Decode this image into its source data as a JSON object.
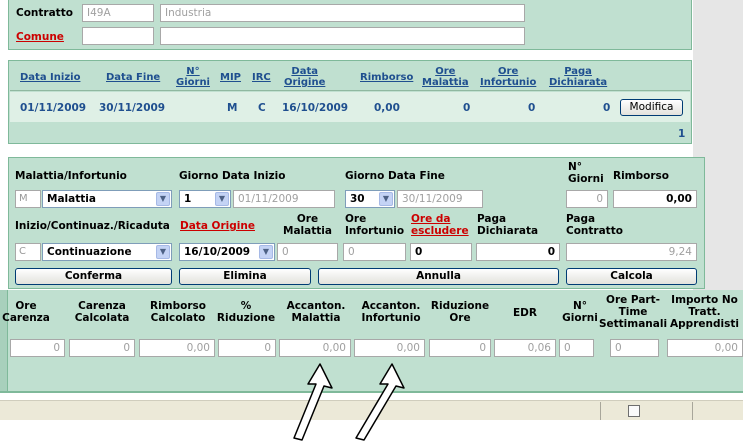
{
  "top": {
    "contratto_label": "Contratto",
    "contratto_code": "I49A",
    "contratto_desc": "Industria",
    "comune_label": "Comune",
    "comune_code": "",
    "comune_desc": ""
  },
  "grid": {
    "headers": [
      "Data Inizio",
      "Data Fine",
      "N°\nGiorni",
      "MIP",
      "IRC",
      "Data\nOrigine",
      "Rimborso",
      "Ore\nMalattia",
      "Ore\nInfortunio",
      "Paga\nDichiarata"
    ],
    "row": {
      "data_inizio": "01/11/2009",
      "data_fine": "30/11/2009",
      "n_giorni": "",
      "mip": "M",
      "irc": "C",
      "data_origine": "16/10/2009",
      "rimborso": "0,00",
      "ore_malattia": "0",
      "ore_infortunio": "0",
      "paga_dichiarata": "0"
    },
    "modifica_label": "Modifica",
    "page_number": "1"
  },
  "form": {
    "malattia_label": "Malattia/Infortunio",
    "malattia_code": "M",
    "malattia_value": "Malattia",
    "giorno_inizio_label": "Giorno Data Inizio",
    "giorno_inizio_value": "1",
    "data_inizio_value": "01/11/2009",
    "giorno_fine_label": "Giorno Data Fine",
    "giorno_fine_value": "30",
    "data_fine_value": "30/11/2009",
    "n_giorni_label": "N°\nGiorni",
    "n_giorni_value": "0",
    "rimborso_label": "Rimborso",
    "rimborso_value": "0,00",
    "inizio_label": "Inizio/Continuaz./Ricaduta",
    "data_origine_label": "Data Origine",
    "ore_malattia_label": "Ore\nMalattia",
    "ore_infortunio_label": "Ore\nInfortunio",
    "ore_escludere_label": "Ore da\nescludere",
    "paga_dichiarata_label": "Paga\nDichiarata",
    "paga_contratto_label": "Paga\nContratto",
    "inizio_code": "C",
    "inizio_value": "Continuazione",
    "data_origine_value": "16/10/2009",
    "ore_malattia_value": "0",
    "ore_infortunio_value": "0",
    "ore_escludere_value": "0",
    "paga_dichiarata_value": "0",
    "paga_contratto_value": "9,24",
    "conferma_label": "Conferma",
    "elimina_label": "Elimina",
    "annulla_label": "Annulla",
    "calcola_label": "Calcola"
  },
  "results": {
    "headers": [
      "Ore\nCarenza",
      "Carenza\nCalcolata",
      "Rimborso\nCalcolato",
      "%\nRiduzione",
      "Accanton.\nMalattia",
      "Accanton.\nInfortunio",
      "Riduzione\nOre",
      "EDR",
      "N°\nGiorni",
      "Ore Part-\nTime\nSettimanali",
      "Importo No\nTratt.\nApprendisti"
    ],
    "values": [
      "0",
      "0",
      "0,00",
      "0",
      "0,00",
      "0,00",
      "0",
      "0,06",
      "0",
      "0",
      "0,00"
    ]
  }
}
